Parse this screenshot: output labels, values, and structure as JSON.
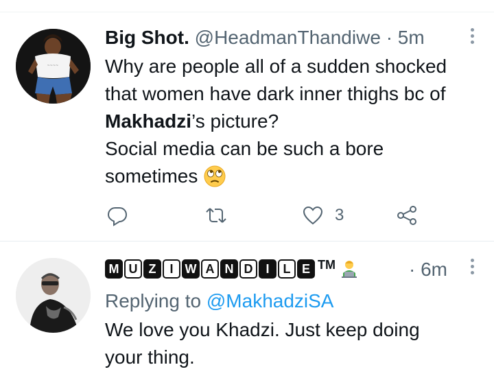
{
  "tweets": [
    {
      "display_name": "Big Shot.",
      "handle": "@HeadmanThandiwe",
      "separator": "·",
      "time": "5m",
      "lines": [
        {
          "text": "Why are people all of a sudden shocked"
        },
        {
          "text": "that women have dark inner thighs bc of"
        },
        {
          "bold": "Makhadzi",
          "rest": "’s picture?"
        },
        {
          "text": "Social media can be such a bore"
        },
        {
          "text": "sometimes"
        }
      ],
      "emoji": "face-with-rolling-eyes",
      "actions": {
        "like_count": "3"
      }
    },
    {
      "name_chips": [
        "M",
        "U",
        "Z",
        "I",
        "W",
        "A",
        "N",
        "D",
        "I",
        "L",
        "E"
      ],
      "chip_styles": [
        "dark",
        "light",
        "dark",
        "light",
        "dark",
        "light",
        "dark",
        "light",
        "dark",
        "light",
        "dark"
      ],
      "trademark": "TM",
      "separator": "·",
      "time": "6m",
      "replying_label": "Replying to",
      "replying_to": "@MakhadziSA",
      "lines": [
        {
          "text": "We love you Khadzi. Just keep doing"
        },
        {
          "text": "your thing."
        }
      ]
    }
  ],
  "colors": {
    "text": "#0f1419",
    "secondary": "#536471",
    "link": "#1d9bf0",
    "divider": "#e6ecf0"
  }
}
